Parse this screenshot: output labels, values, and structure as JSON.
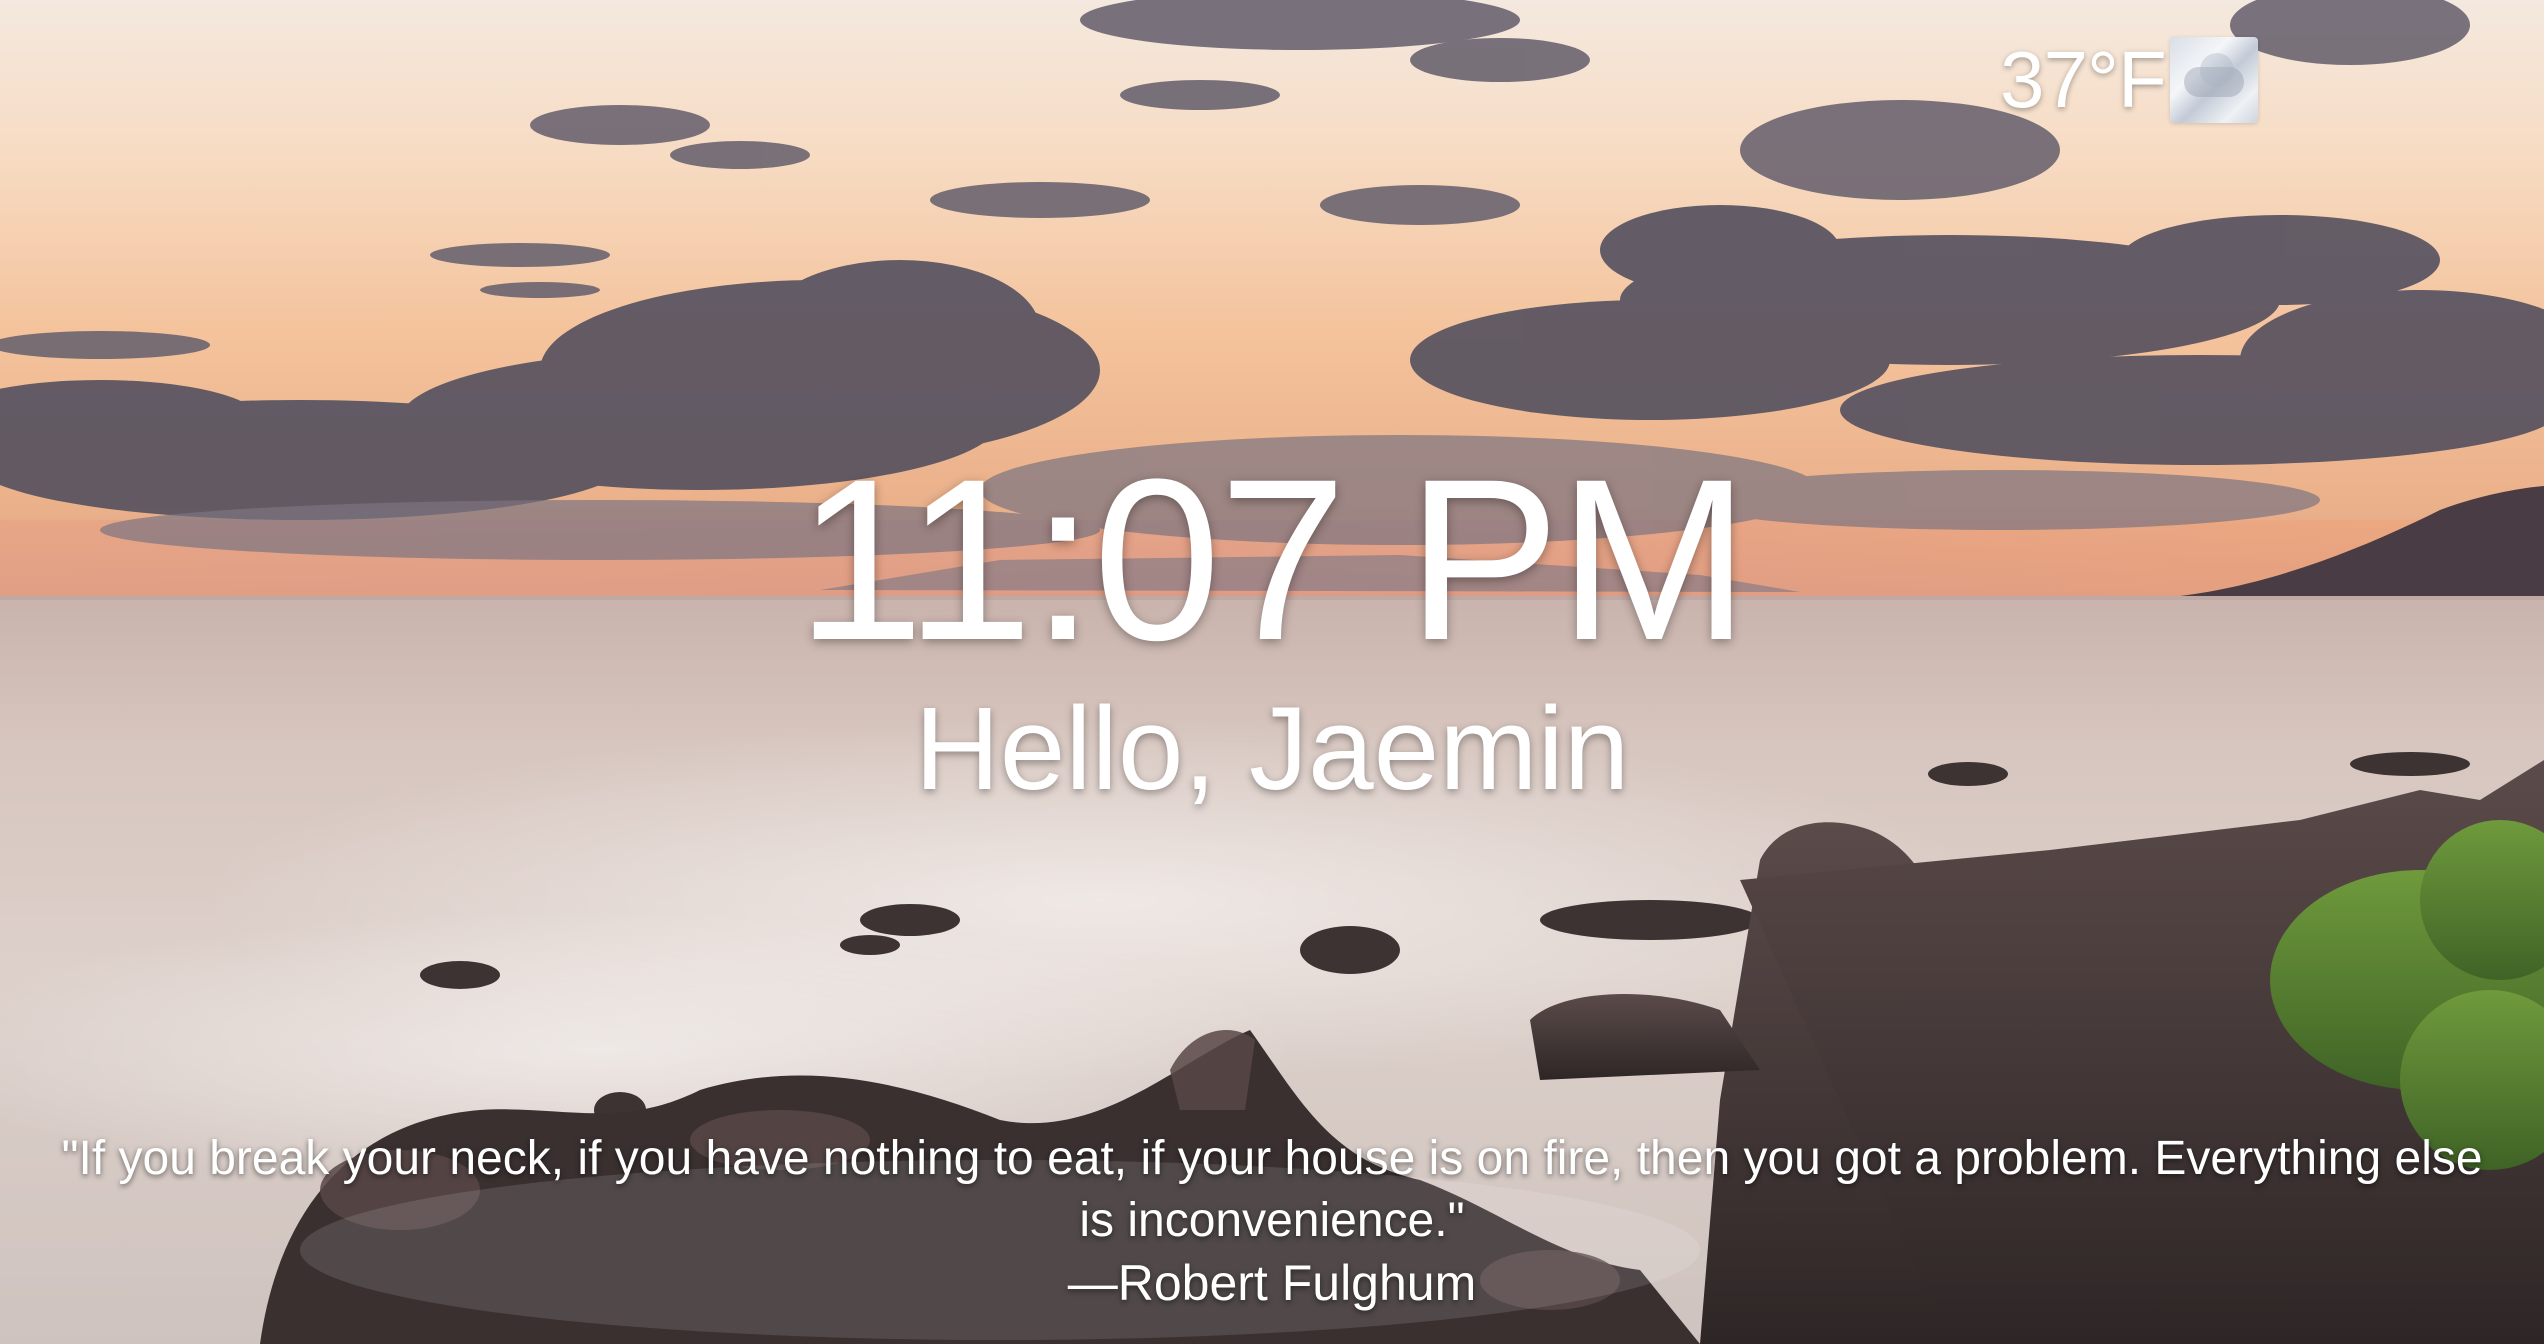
{
  "weather": {
    "temperature": "37°F",
    "icon": "cloudy-icon"
  },
  "clock": {
    "time": "11:07 PM"
  },
  "greeting": {
    "text": "Hello, Jaemin"
  },
  "quote": {
    "text": "\"If you break your neck, if you have nothing to eat, if your house is on fire, then you got a problem. Everything else is inconvenience.\"",
    "author": "—Robert Fulghum"
  }
}
